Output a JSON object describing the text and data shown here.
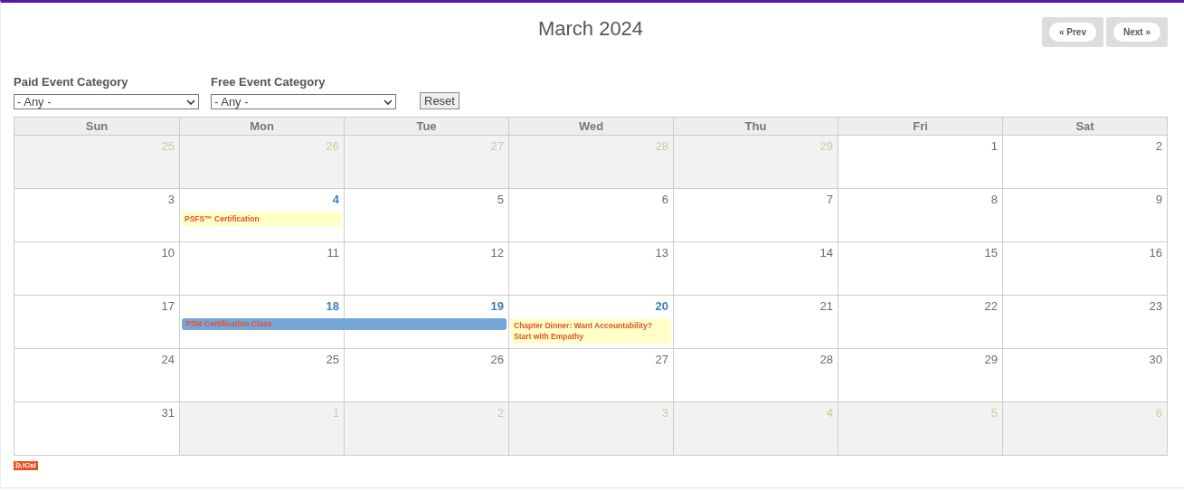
{
  "title": "March 2024",
  "nav": [
    {
      "label": "« Prev"
    },
    {
      "label": "Next »"
    }
  ],
  "filters": [
    {
      "label": "Paid Event Category",
      "value": "- Any -"
    },
    {
      "label": "Free Event Category",
      "value": "- Any -"
    }
  ],
  "reset_button": "Reset",
  "weekdays": [
    "Sun",
    "Mon",
    "Tue",
    "Wed",
    "Thu",
    "Fri",
    "Sat"
  ],
  "weeks": [
    {
      "days": [
        {
          "day": "25",
          "outside": true,
          "has_events": false
        },
        {
          "day": "26",
          "outside": true,
          "has_events": false
        },
        {
          "day": "27",
          "outside": true,
          "has_events": false
        },
        {
          "day": "28",
          "outside": true,
          "has_events": false
        },
        {
          "day": "29",
          "outside": true,
          "has_events": false
        },
        {
          "day": "1",
          "outside": false,
          "has_events": false
        },
        {
          "day": "2",
          "outside": false,
          "has_events": false
        }
      ]
    },
    {
      "days": [
        {
          "day": "3",
          "outside": false,
          "has_events": false
        },
        {
          "day": "4",
          "outside": false,
          "has_events": true,
          "events": [
            {
              "title": "PSFS™ Certification",
              "kind": "note",
              "spans_next_day": false
            }
          ]
        },
        {
          "day": "5",
          "outside": false,
          "has_events": false
        },
        {
          "day": "6",
          "outside": false,
          "has_events": false
        },
        {
          "day": "7",
          "outside": false,
          "has_events": false
        },
        {
          "day": "8",
          "outside": false,
          "has_events": false
        },
        {
          "day": "9",
          "outside": false,
          "has_events": false
        }
      ]
    },
    {
      "days": [
        {
          "day": "10",
          "outside": false,
          "has_events": false
        },
        {
          "day": "11",
          "outside": false,
          "has_events": false
        },
        {
          "day": "12",
          "outside": false,
          "has_events": false
        },
        {
          "day": "13",
          "outside": false,
          "has_events": false
        },
        {
          "day": "14",
          "outside": false,
          "has_events": false
        },
        {
          "day": "15",
          "outside": false,
          "has_events": false
        },
        {
          "day": "16",
          "outside": false,
          "has_events": false
        }
      ]
    },
    {
      "days": [
        {
          "day": "17",
          "outside": false,
          "has_events": false
        },
        {
          "day": "18",
          "outside": false,
          "has_events": true,
          "events": [
            {
              "title": "PSM Certification Class",
              "kind": "bar",
              "spans_next_day": true
            }
          ]
        },
        {
          "day": "19",
          "outside": false,
          "has_events": true
        },
        {
          "day": "20",
          "outside": false,
          "has_events": true,
          "events": [
            {
              "title": "Chapter Dinner: Want Accountability? Start with Empathy",
              "kind": "note",
              "spans_next_day": false
            }
          ]
        },
        {
          "day": "21",
          "outside": false,
          "has_events": false
        },
        {
          "day": "22",
          "outside": false,
          "has_events": false
        },
        {
          "day": "23",
          "outside": false,
          "has_events": false
        }
      ]
    },
    {
      "days": [
        {
          "day": "24",
          "outside": false,
          "has_events": false
        },
        {
          "day": "25",
          "outside": false,
          "has_events": false
        },
        {
          "day": "26",
          "outside": false,
          "has_events": false
        },
        {
          "day": "27",
          "outside": false,
          "has_events": false
        },
        {
          "day": "28",
          "outside": false,
          "has_events": false
        },
        {
          "day": "29",
          "outside": false,
          "has_events": false
        },
        {
          "day": "30",
          "outside": false,
          "has_events": false
        }
      ]
    },
    {
      "days": [
        {
          "day": "31",
          "outside": false,
          "has_events": false
        },
        {
          "day": "1",
          "outside": true,
          "has_events": false
        },
        {
          "day": "2",
          "outside": true,
          "has_events": false
        },
        {
          "day": "3",
          "outside": true,
          "has_events": false
        },
        {
          "day": "4",
          "outside": true,
          "has_events": false
        },
        {
          "day": "5",
          "outside": true,
          "has_events": false
        },
        {
          "day": "6",
          "outside": true,
          "has_events": false
        }
      ]
    }
  ],
  "ical_badge": "iCal"
}
